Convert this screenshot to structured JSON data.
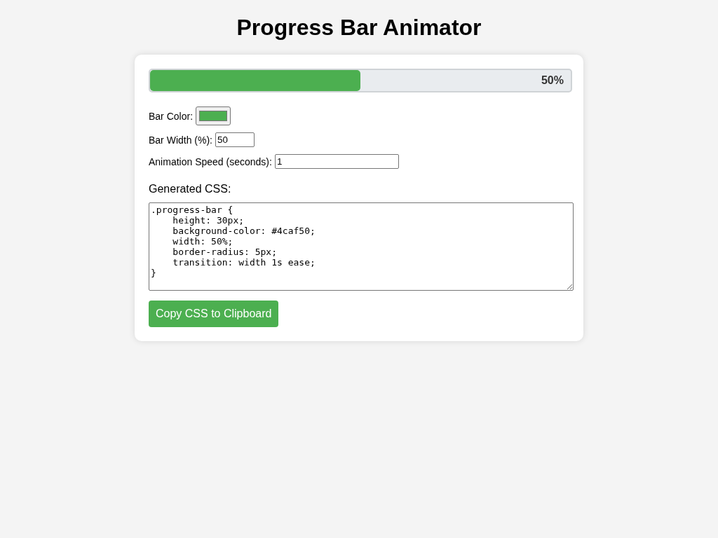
{
  "title": "Progress Bar Animator",
  "progress_bar": {
    "level": 0.5,
    "label": "50%"
  },
  "controls": [
    {
      "kind": "color",
      "label": "Bar Color:",
      "color": "#4caf50"
    },
    {
      "kind": "number",
      "label": "Bar Width (%):",
      "value": "50"
    },
    {
      "kind": "text",
      "label": "Animation Speed (seconds):",
      "value": "1"
    }
  ],
  "generated_css": {
    "heading": "Generated CSS:",
    "code": ".progress-bar {\n    height: 30px;\n    background-color: #4caf50;\n    width: 50%;\n    border-radius: 5px;\n    transition: width 1s ease;\n}"
  },
  "copy_button": {
    "label": "Copy CSS to Clipboard"
  }
}
